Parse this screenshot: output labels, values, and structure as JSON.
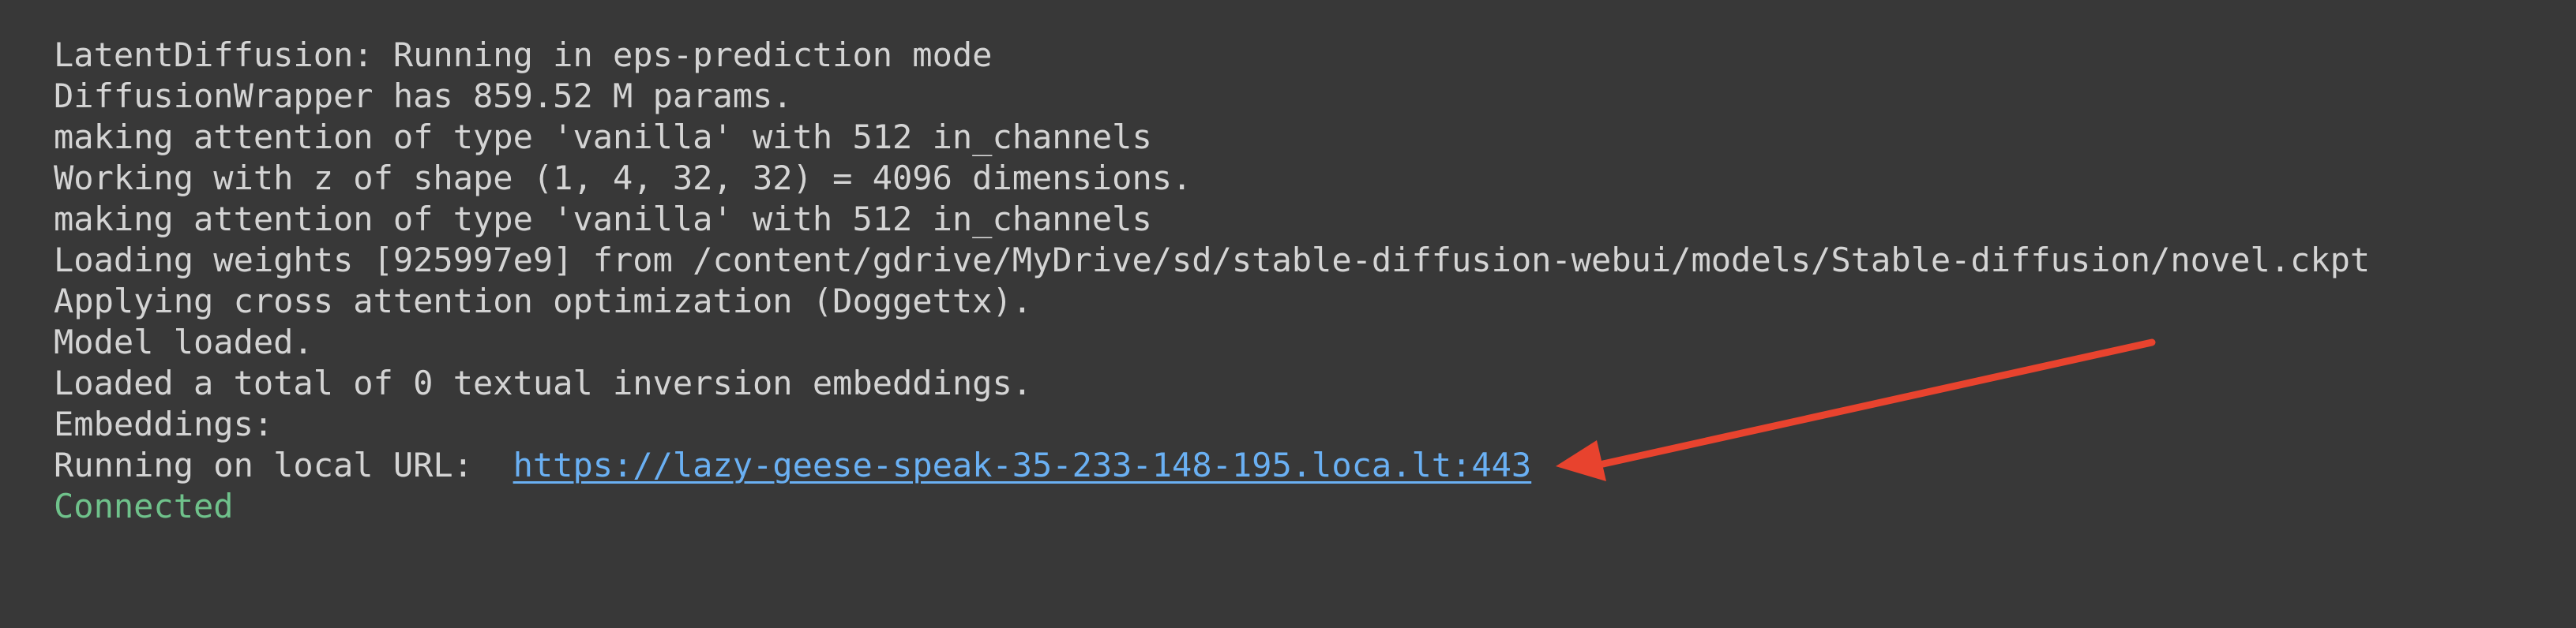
{
  "output": {
    "lines": [
      "LatentDiffusion: Running in eps-prediction mode",
      "DiffusionWrapper has 859.52 M params.",
      "making attention of type 'vanilla' with 512 in_channels",
      "Working with z of shape (1, 4, 32, 32) = 4096 dimensions.",
      "making attention of type 'vanilla' with 512 in_channels",
      "Loading weights [925997e9] from /content/gdrive/MyDrive/sd/stable-diffusion-webui/models/Stable-diffusion/novel.ckpt",
      "Applying cross attention optimization (Doggettx).",
      "Model loaded.",
      "Loaded a total of 0 textual inversion embeddings.",
      "Embeddings:"
    ],
    "url_prefix": "Running on local URL:  ",
    "url": "https://lazy-geese-speak-35-233-148-195.loca.lt:443",
    "status": "Connected"
  },
  "colors": {
    "background": "#383838",
    "text": "#d4d4d4",
    "link": "#6ab0f3",
    "status": "#6fc28b",
    "arrow": "#e8432e"
  },
  "annotation": {
    "icon": "red-arrow-icon"
  }
}
